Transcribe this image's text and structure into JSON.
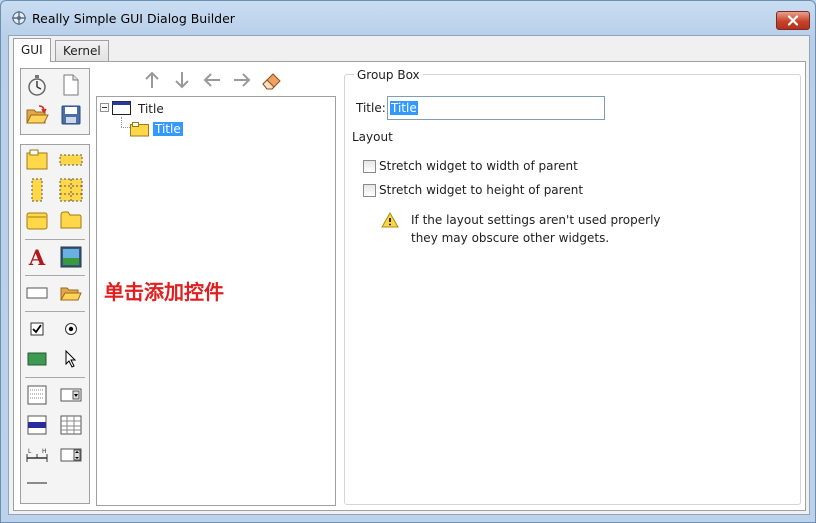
{
  "window": {
    "title": "Really Simple GUI Dialog Builder"
  },
  "tabs": [
    {
      "label": "GUI"
    },
    {
      "label": "Kernel"
    }
  ],
  "tree": {
    "root_label": "Title",
    "child_label": "Title"
  },
  "hint_text": "单击添加控件",
  "props": {
    "group_title": "Group Box",
    "title_label": "Title:",
    "title_value": "Title",
    "layout_label": "Layout",
    "stretch_width_label": "Stretch widget to width of parent",
    "stretch_height_label": "Stretch widget to height of parent",
    "warning_line1": "If the layout settings aren't used properly",
    "warning_line2": "they may obscure other widgets."
  },
  "icons": {
    "toolbox_top": [
      "timer-icon",
      "new-file-icon",
      "open-folder-icon",
      "save-icon"
    ],
    "toolbox": [
      "groupbox-icon",
      "frame-icon",
      "vertical-frame-icon",
      "grid-layout-icon",
      "folder-tab-icon",
      "tab-folder-icon",
      "label-icon",
      "image-icon",
      "line-edit-icon",
      "file-picker-icon",
      "checkbox-icon",
      "radiobutton-icon",
      "button-icon",
      "cursor-icon",
      "listbox-icon",
      "combobox-icon",
      "progressbar-icon",
      "table-icon",
      "slider-icon",
      "spinbox-icon",
      "separator-icon"
    ],
    "arrows": [
      "arrow-up-icon",
      "arrow-down-icon",
      "arrow-left-icon",
      "arrow-right-icon",
      "eraser-icon"
    ]
  },
  "colors": {
    "selection": "#3399ff",
    "hint": "#e02020",
    "folder": "#ffd84a"
  }
}
